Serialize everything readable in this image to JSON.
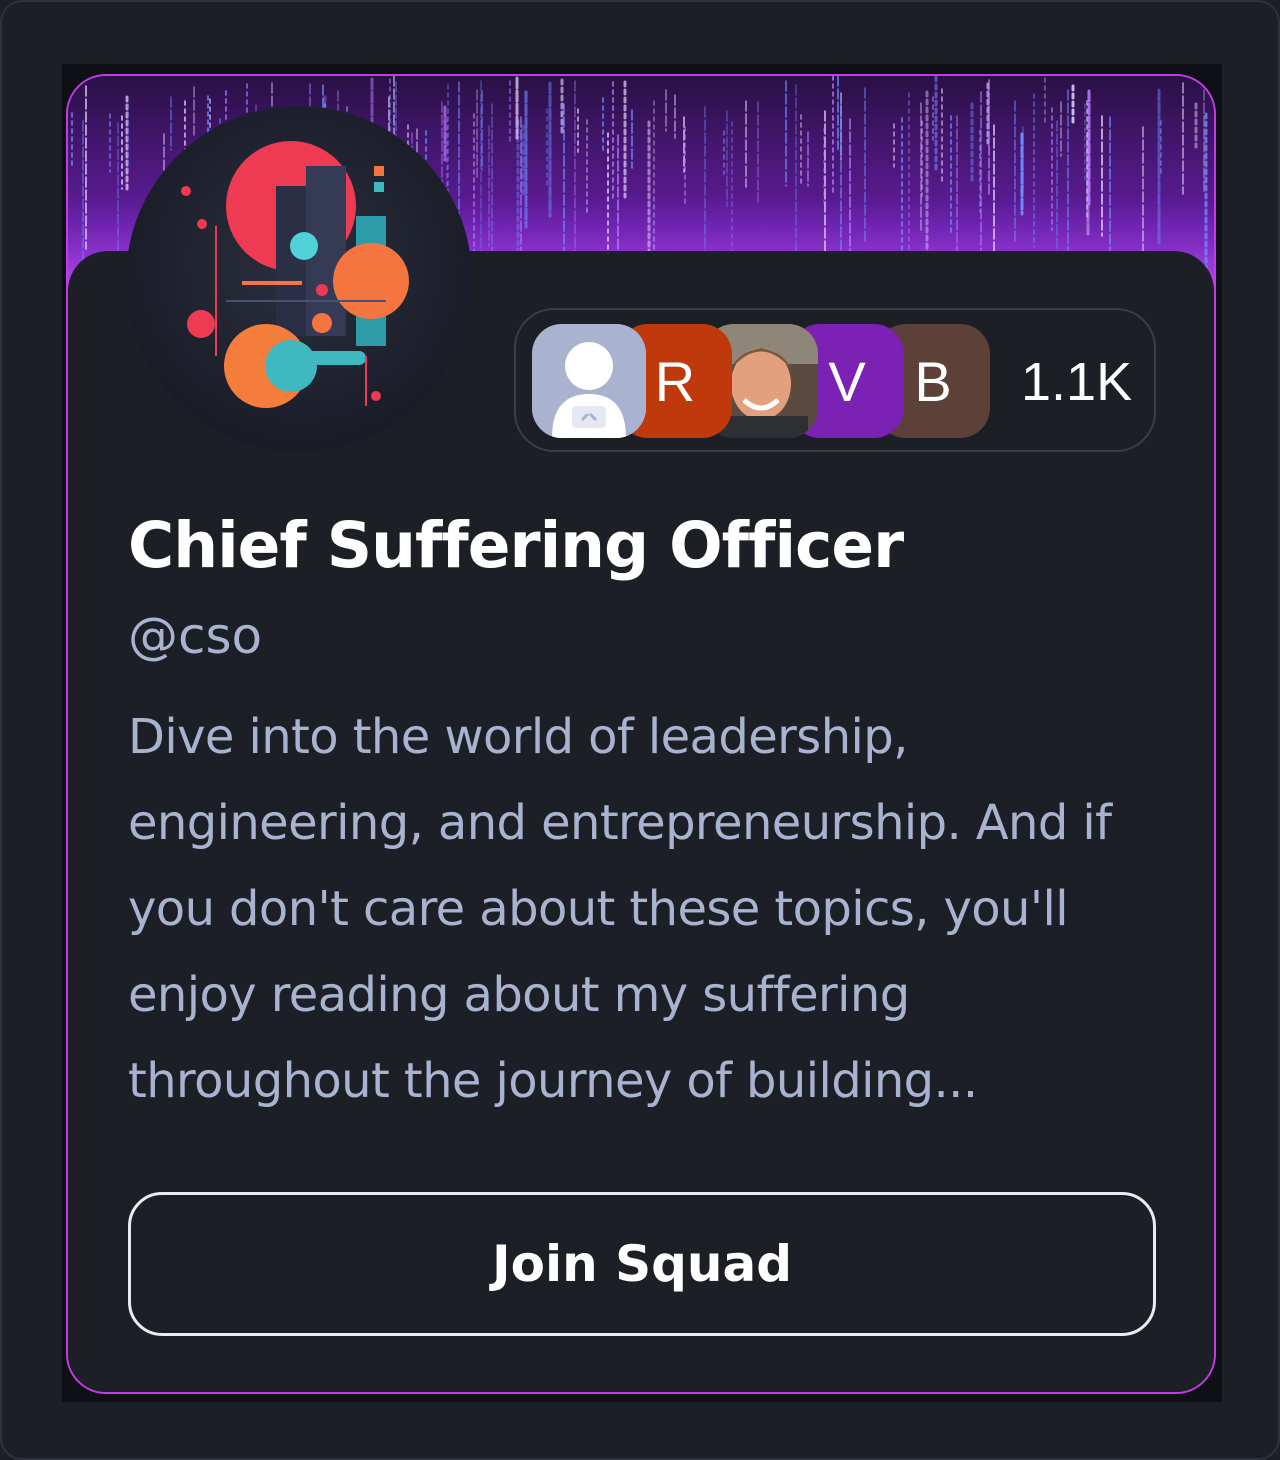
{
  "squad": {
    "name": "Chief Suffering Officer",
    "handle": "@cso",
    "description": "Dive into the world of leadership, engineering, and entrepreneurship. And if you don't care about these topics, you'll enjoy reading about my suffering throughout the journey of building...",
    "logo_icon": "abstract-geometric-logo"
  },
  "members": {
    "avatars": [
      {
        "type": "image",
        "icon": "default-user-avatar",
        "color": "#a9b3d0"
      },
      {
        "type": "initial",
        "initial": "R",
        "color": "#c0390c"
      },
      {
        "type": "image",
        "icon": "user-photo-avatar",
        "color": "#5b4a3f"
      },
      {
        "type": "initial",
        "initial": "V",
        "color": "#7b22b5"
      },
      {
        "type": "initial",
        "initial": "B",
        "color": "#5d4037"
      }
    ],
    "count": "1.1K"
  },
  "actions": {
    "join_label": "Join Squad"
  },
  "colors": {
    "accent_border": "#c23ce6",
    "card_bg": "#1c1f26",
    "text_secondary": "#a8b3cf"
  }
}
